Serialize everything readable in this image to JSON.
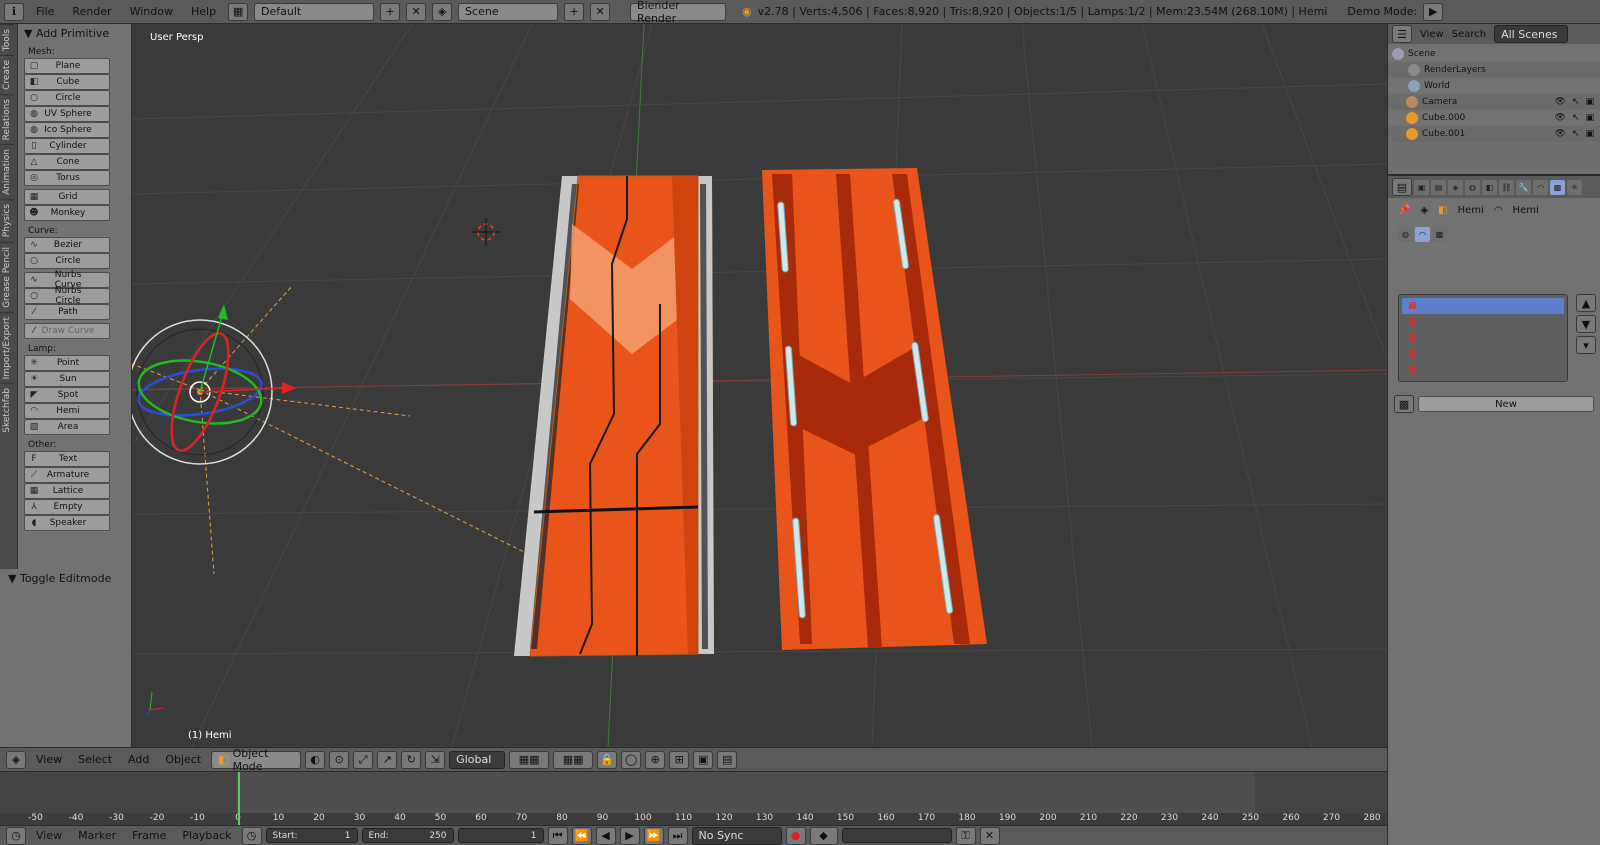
{
  "topbar": {
    "menus": [
      "File",
      "Render",
      "Window",
      "Help"
    ],
    "layout": "Default",
    "scene": "Scene",
    "engine": "Blender Render",
    "stats": "v2.78 | Verts:4,506 | Faces:8,920 | Tris:8,920 | Objects:1/5 | Lamps:1/2 | Mem:23.54M (268.10M) | Hemi",
    "demo_mode": "Demo Mode:"
  },
  "tabs": [
    "Tools",
    "Create",
    "Relations",
    "Animation",
    "Physics",
    "Grease Pencil",
    "Import/Export",
    "Sketchfab"
  ],
  "toolshelf": {
    "panel_title": "Add Primitive",
    "mesh_label": "Mesh:",
    "mesh": [
      {
        "label": "Plane",
        "icon": "▢"
      },
      {
        "label": "Cube",
        "icon": "◧"
      },
      {
        "label": "Circle",
        "icon": "○"
      },
      {
        "label": "UV Sphere",
        "icon": "◍"
      },
      {
        "label": "Ico Sphere",
        "icon": "◍"
      },
      {
        "label": "Cylinder",
        "icon": "▯"
      },
      {
        "label": "Cone",
        "icon": "△"
      },
      {
        "label": "Torus",
        "icon": "◎"
      }
    ],
    "mesh2": [
      {
        "label": "Grid",
        "icon": "▦"
      },
      {
        "label": "Monkey",
        "icon": "☻"
      }
    ],
    "curve_label": "Curve:",
    "curve": [
      {
        "label": "Bezier",
        "icon": "∿"
      },
      {
        "label": "Circle",
        "icon": "○"
      }
    ],
    "curve2": [
      {
        "label": "Nurbs Curve",
        "icon": "∿"
      },
      {
        "label": "Nurbs Circle",
        "icon": "○"
      },
      {
        "label": "Path",
        "icon": "⁄"
      }
    ],
    "draw_curve": "Draw Curve",
    "lamp_label": "Lamp:",
    "lamp": [
      {
        "label": "Point",
        "icon": "✳"
      },
      {
        "label": "Sun",
        "icon": "☀"
      },
      {
        "label": "Spot",
        "icon": "◤"
      },
      {
        "label": "Hemi",
        "icon": "◠"
      },
      {
        "label": "Area",
        "icon": "▧"
      }
    ],
    "other_label": "Other:",
    "other": [
      {
        "label": "Text",
        "icon": "F"
      },
      {
        "label": "Armature",
        "icon": "⟋"
      },
      {
        "label": "Lattice",
        "icon": "▦"
      },
      {
        "label": "Empty",
        "icon": "⅄"
      },
      {
        "label": "Speaker",
        "icon": "◖"
      }
    ],
    "toggle_editmode": "Toggle Editmode"
  },
  "viewport": {
    "view_label": "User Persp",
    "object_label": "(1) Hemi"
  },
  "vp_header": {
    "menus": [
      "View",
      "Select",
      "Add",
      "Object"
    ],
    "mode": "Object Mode",
    "orientation": "Global"
  },
  "timeline": {
    "ticks": [
      "-50",
      "-40",
      "-30",
      "-20",
      "-10",
      "0",
      "10",
      "20",
      "30",
      "40",
      "50",
      "60",
      "70",
      "80",
      "90",
      "100",
      "110",
      "120",
      "130",
      "140",
      "150",
      "160",
      "170",
      "180",
      "190",
      "200",
      "210",
      "220",
      "230",
      "240",
      "250",
      "260",
      "270",
      "280"
    ],
    "menus": [
      "View",
      "Marker",
      "Frame",
      "Playback"
    ],
    "start_label": "Start:",
    "start": "1",
    "end_label": "End:",
    "end": "250",
    "current": "1",
    "sync": "No Sync"
  },
  "outliner": {
    "menus": [
      "View",
      "Search"
    ],
    "scope": "All Scenes",
    "items": [
      {
        "label": "Scene",
        "color": "#9a9ab0"
      },
      {
        "label": "RenderLayers",
        "color": "#8a8a8a"
      },
      {
        "label": "World",
        "color": "#8aa0b8"
      },
      {
        "label": "Camera",
        "color": "#b88a55"
      },
      {
        "label": "Cube.000",
        "color": "#e59a2a"
      },
      {
        "label": "Cube.001",
        "color": "#e59a2a"
      }
    ]
  },
  "properties": {
    "breadcrumb_1": "Hemi",
    "breadcrumb_2": "Hemi",
    "new_button": "New"
  },
  "colors": {
    "panel": "#727272",
    "viewport": "#3a3a3a",
    "header": "#5a5a5a",
    "accent_orange": "#e8541a",
    "selection": "#5c7fcc"
  }
}
